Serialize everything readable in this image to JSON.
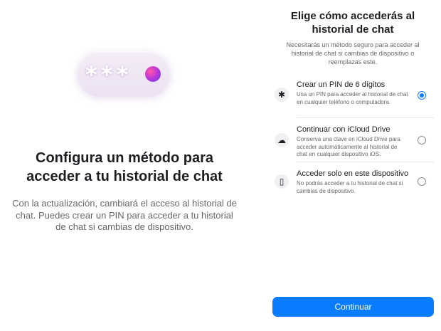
{
  "left": {
    "hero_stars": "***",
    "title": "Configura un método para acceder a tu historial de chat",
    "description": "Con la actualización, cambiará el acceso al historial de chat. Puedes crear un PIN para acceder a tu historial de chat si cambias de dispositivo."
  },
  "right": {
    "title": "Elige cómo accederás al historial de chat",
    "subtitle": "Necesitarás un método seguro para acceder al historial de chat si cambias de dispositivo o reemplazas este.",
    "options": [
      {
        "icon": "asterisk-icon",
        "icon_glyph": "✱",
        "label": "Crear un PIN de 6 dígitos",
        "description": "Usa un PIN para acceder al historial de chat en cualquier teléfono o computadora.",
        "selected": true
      },
      {
        "icon": "cloud-upload-icon",
        "icon_glyph": "☁",
        "label": "Continuar con iCloud Drive",
        "description": "Conserva una clave en iCloud Drive para acceder automáticamente al historial de chat en cualquier dispositivo iOS.",
        "selected": false
      },
      {
        "icon": "phone-icon",
        "icon_glyph": "▯",
        "label": "Acceder solo en este dispositivo",
        "description": "No podrás acceder a tu historial de chat si cambias de dispositivo.",
        "selected": false
      }
    ],
    "continue_label": "Continuar"
  },
  "colors": {
    "accent": "#0a7cff",
    "text_primary": "#1c1e21",
    "text_secondary": "#65676b"
  }
}
